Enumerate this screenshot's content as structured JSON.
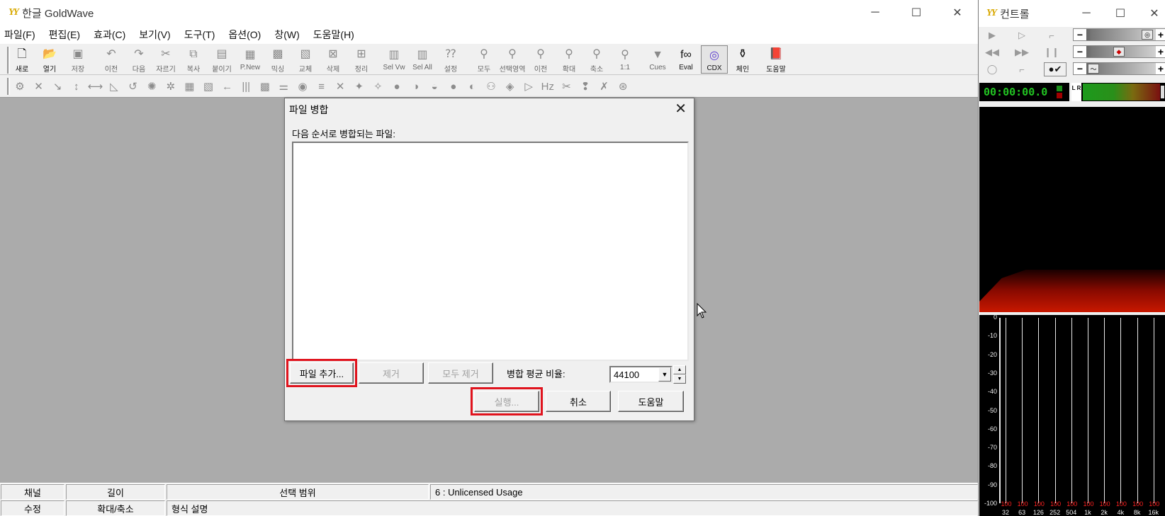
{
  "main_window": {
    "title": "한글 GoldWave",
    "logo": "YY",
    "controls": [
      "─",
      "☐",
      "✕"
    ]
  },
  "menu": [
    "파일(F)",
    "편집(E)",
    "효과(C)",
    "보기(V)",
    "도구(T)",
    "옵션(O)",
    "창(W)",
    "도움말(H)"
  ],
  "toolbar": {
    "buttons": [
      {
        "label": "새로",
        "icon": "new-file-icon",
        "glyph": "🗋"
      },
      {
        "label": "열기",
        "icon": "open-folder-icon",
        "glyph": "📂"
      },
      {
        "label": "저장",
        "icon": "save-icon",
        "glyph": "▣"
      },
      {
        "label": "이전",
        "icon": "undo-icon",
        "glyph": "↶"
      },
      {
        "label": "다음",
        "icon": "redo-icon",
        "glyph": "↷"
      },
      {
        "label": "자르기",
        "icon": "cut-icon",
        "glyph": "✂"
      },
      {
        "label": "복사",
        "icon": "copy-icon",
        "glyph": "⧉"
      },
      {
        "label": "붙이기",
        "icon": "paste-icon",
        "glyph": "▤"
      },
      {
        "label": "P.New",
        "icon": "paste-new-icon",
        "glyph": "▦"
      },
      {
        "label": "믹싱",
        "icon": "mix-icon",
        "glyph": "▩"
      },
      {
        "label": "교체",
        "icon": "replace-icon",
        "glyph": "▧"
      },
      {
        "label": "삭제",
        "icon": "delete-icon",
        "glyph": "⊠"
      },
      {
        "label": "정리",
        "icon": "trim-icon",
        "glyph": "⊞"
      },
      {
        "label": "Sel Vw",
        "icon": "select-view-icon",
        "glyph": "▥"
      },
      {
        "label": "Sel All",
        "icon": "select-all-icon",
        "glyph": "▥"
      },
      {
        "label": "설정",
        "icon": "set-icon",
        "glyph": "⁇"
      },
      {
        "label": "모두",
        "icon": "zoom-all-icon",
        "glyph": "⚲"
      },
      {
        "label": "선택영역",
        "icon": "zoom-selection-icon",
        "glyph": "⚲"
      },
      {
        "label": "이전",
        "icon": "zoom-previous-icon",
        "glyph": "⚲"
      },
      {
        "label": "확대",
        "icon": "zoom-in-icon",
        "glyph": "⚲"
      },
      {
        "label": "축소",
        "icon": "zoom-out-icon",
        "glyph": "⚲"
      },
      {
        "label": "1:1",
        "icon": "zoom-1-1-icon",
        "glyph": "⚲"
      },
      {
        "label": "Cues",
        "icon": "cues-icon",
        "glyph": "▼"
      },
      {
        "label": "Eval",
        "icon": "eval-icon",
        "glyph": "f∞"
      },
      {
        "label": "CDX",
        "icon": "cd-icon",
        "glyph": "◎"
      },
      {
        "label": "체인",
        "icon": "chain-icon",
        "glyph": "⚱"
      },
      {
        "label": "도움말",
        "icon": "help-book-icon",
        "glyph": "📕"
      }
    ]
  },
  "effects_toolbar": {
    "icons": [
      "⚙",
      "✕",
      "↘",
      "↕",
      "⟷",
      "◺",
      "↺",
      "✺",
      "✲",
      "▦",
      "▧",
      "←",
      "|||",
      "▩",
      "⚌",
      "◉",
      "≡",
      "✕",
      "✦",
      "✧",
      "●",
      "◑",
      "◒",
      "●",
      "◐",
      "⚇",
      "◈",
      "▷",
      "Hz",
      "✂",
      "❢",
      "✗",
      "⊛"
    ]
  },
  "status_bar": {
    "row1": [
      "채널",
      "길이",
      "선택 범위",
      "6 : Unlicensed Usage"
    ],
    "row2": [
      "수정",
      "확대/축소",
      "형식 설명"
    ]
  },
  "dialog": {
    "title": "파일 병합",
    "caption": "다음 순서로 병합되는 파일:",
    "add_button": "파일 추가...",
    "remove_button": "제거",
    "remove_all_button": "모두 제거",
    "rate_label": "병합 평균 비율:",
    "rate_value": "44100",
    "run_button": "실행...",
    "cancel_button": "취소",
    "help_button": "도움말",
    "highlight_color": "#e0141e"
  },
  "control_window": {
    "title": "컨트롤",
    "logo": "YY",
    "time": "00:00:00.0",
    "lr_label": "L R",
    "eq_y_ticks": [
      "0",
      "-10",
      "-20",
      "-30",
      "-40",
      "-50",
      "-60",
      "-70",
      "-80",
      "-90",
      "-100"
    ],
    "eq_peaks": [
      "100",
      "100",
      "100",
      "100",
      "100",
      "100",
      "100",
      "100",
      "100",
      "100"
    ],
    "eq_freqs": [
      "32",
      "63",
      "126",
      "252",
      "504",
      "1k",
      "2k",
      "4k",
      "8k",
      "16k"
    ]
  }
}
